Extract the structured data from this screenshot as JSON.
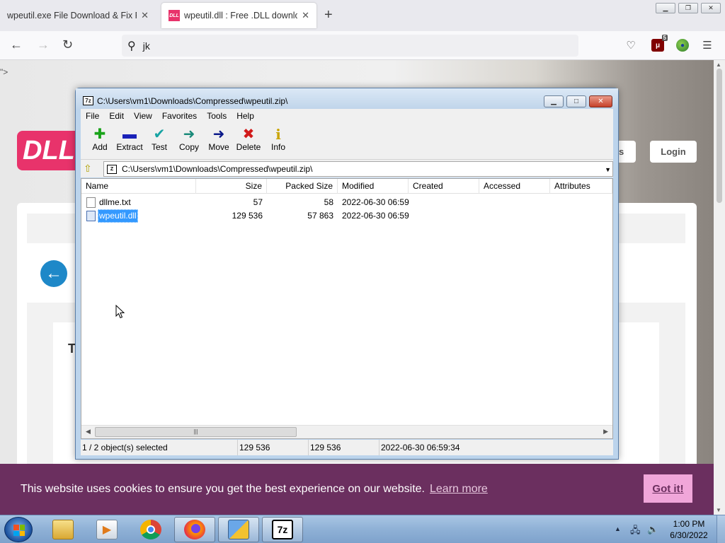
{
  "browser": {
    "tabs": [
      {
        "title": "wpeutil.exe File Download & Fix For",
        "active": false
      },
      {
        "title": "wpeutil.dll : Free .DLL download",
        "active": true
      }
    ],
    "tab_close_glyph": "✕",
    "new_tab_glyph": "+",
    "favicon_text": "DLL",
    "address_text": "jk",
    "ublock_count": "5",
    "window_buttons": [
      "minimize",
      "restore",
      "close"
    ]
  },
  "webpage": {
    "stray_text": "\">",
    "logo_text": "DLL",
    "les_text": "es",
    "login_label": "Login",
    "heading_fragment": "T",
    "back_glyph": "←"
  },
  "cookie_banner": {
    "message": "This website uses cookies to ensure you get the best experience on our website.",
    "learn_more": "Learn more",
    "got_it": "Got it!",
    "background": "#6b2f5f",
    "button_color": "#f0a6d9"
  },
  "sevenzip": {
    "title": "C:\\Users\\vm1\\Downloads\\Compressed\\wpeutil.zip\\",
    "icon_text": "7z",
    "menu": [
      "File",
      "Edit",
      "View",
      "Favorites",
      "Tools",
      "Help"
    ],
    "toolbar": [
      {
        "label": "Add",
        "icon": "plus-icon",
        "glyph": "✚",
        "color": "#1aa31a"
      },
      {
        "label": "Extract",
        "icon": "minus-icon",
        "glyph": "▬",
        "color": "#1a22b8"
      },
      {
        "label": "Test",
        "icon": "check-icon",
        "glyph": "✔",
        "color": "#16a3a3"
      },
      {
        "label": "Copy",
        "icon": "copy-arrow-icon",
        "glyph": "➜",
        "color": "#1a8a7a"
      },
      {
        "label": "Move",
        "icon": "move-arrow-icon",
        "glyph": "➜",
        "color": "#0c1a8a"
      },
      {
        "label": "Delete",
        "icon": "delete-x-icon",
        "glyph": "✖",
        "color": "#d11a1a"
      },
      {
        "label": "Info",
        "icon": "info-icon",
        "glyph": "i",
        "color": "#c9a400"
      }
    ],
    "address": "C:\\Users\\vm1\\Downloads\\Compressed\\wpeutil.zip\\",
    "columns": [
      "Name",
      "Size",
      "Packed Size",
      "Modified",
      "Created",
      "Accessed",
      "Attributes"
    ],
    "files": [
      {
        "name": "dllme.txt",
        "size": "57",
        "packed": "58",
        "modified": "2022-06-30 06:59",
        "created": "",
        "accessed": "",
        "selected": false
      },
      {
        "name": "wpeutil.dll",
        "size": "129 536",
        "packed": "57 863",
        "modified": "2022-06-30 06:59",
        "created": "",
        "accessed": "",
        "selected": true
      }
    ],
    "scroll_grip": "|||",
    "status": {
      "selection": "1 / 2 object(s) selected",
      "size": "129 536",
      "packed": "129 536",
      "modified": "2022-06-30 06:59:34"
    }
  },
  "taskbar": {
    "time": "1:00 PM",
    "date": "6/30/2022",
    "apps": [
      {
        "name": "explorer",
        "active": false
      },
      {
        "name": "media-player",
        "active": false
      },
      {
        "name": "chrome",
        "active": false
      },
      {
        "name": "firefox",
        "active": true
      },
      {
        "name": "installer",
        "active": true
      },
      {
        "name": "7zip",
        "active": true
      }
    ],
    "sevenzip_label": "7z"
  }
}
